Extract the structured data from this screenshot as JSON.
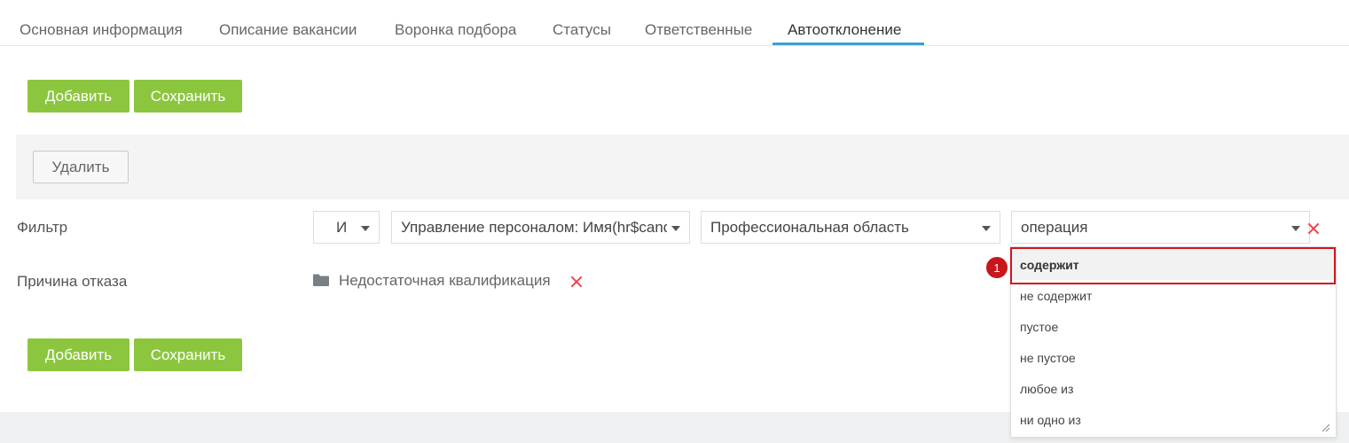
{
  "tabs": [
    {
      "label": "Основная информация"
    },
    {
      "label": "Описание вакансии"
    },
    {
      "label": "Воронка подбора"
    },
    {
      "label": "Статусы"
    },
    {
      "label": "Ответственные"
    },
    {
      "label": "Автоотклонение",
      "active": true
    }
  ],
  "toolbar_top": {
    "add_label": "Добавить",
    "save_label": "Сохранить"
  },
  "panel": {
    "delete_label": "Удалить"
  },
  "filter": {
    "label": "Фильтр",
    "logic_value": "И",
    "field_value": "Управление персоналом: Имя(hr$candidate)",
    "property_value": "Профессиональная область",
    "operation_placeholder": "операция"
  },
  "reason": {
    "label": "Причина отказа",
    "value": "Недостаточная квалификация"
  },
  "operation_options": [
    {
      "label": "содержит",
      "selected": true
    },
    {
      "label": "не содержит"
    },
    {
      "label": "пустое"
    },
    {
      "label": "не пустое"
    },
    {
      "label": "любое из"
    },
    {
      "label": "ни одно из"
    }
  ],
  "annotation": {
    "number": "1"
  },
  "toolbar_bottom": {
    "add_label": "Добавить",
    "save_label": "Сохранить"
  },
  "colors": {
    "accent_green": "#8cc63f",
    "tab_underline": "#3aa1d3",
    "remove_red": "#e8474c",
    "annotation_red": "#d0161c"
  },
  "icons": [
    "chevron-down-icon",
    "close-icon",
    "folder-icon",
    "resize-handle-icon"
  ]
}
